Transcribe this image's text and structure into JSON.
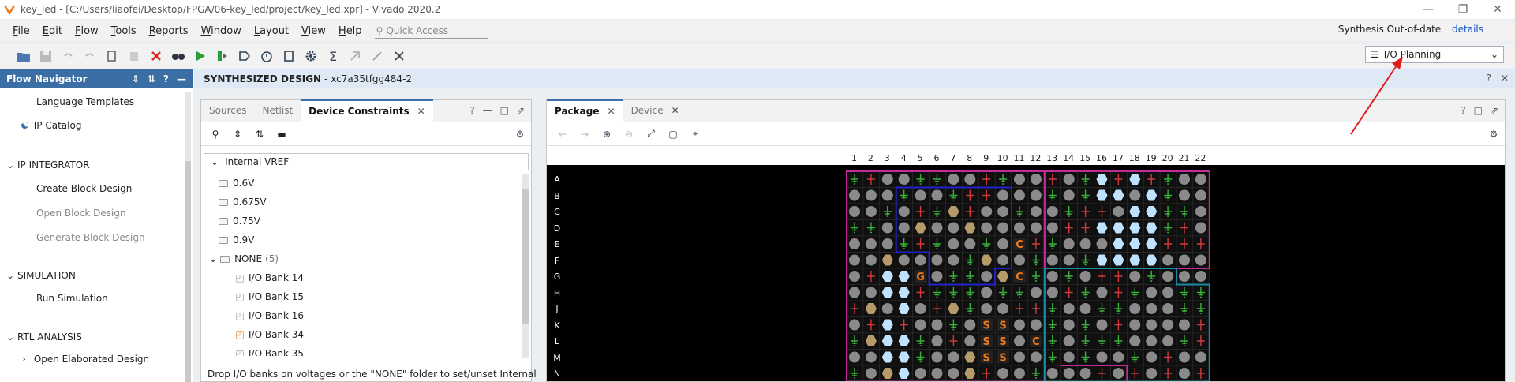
{
  "window": {
    "title": "key_led - [C:/Users/liaofei/Desktop/FPGA/06-key_led/project/key_led.xpr] - Vivado 2020.2"
  },
  "menu": [
    "File",
    "Edit",
    "Flow",
    "Tools",
    "Reports",
    "Window",
    "Layout",
    "View",
    "Help"
  ],
  "quick_access": {
    "placeholder": "Quick Access"
  },
  "status": {
    "text": "Synthesis Out-of-date",
    "link": "details"
  },
  "layout_select": {
    "value": "I/O Planning"
  },
  "flow_nav": {
    "title": "Flow Navigator",
    "items": [
      {
        "type": "item",
        "label": "Language Templates"
      },
      {
        "type": "item",
        "label": "IP Catalog"
      },
      {
        "type": "section",
        "label": "IP INTEGRATOR"
      },
      {
        "type": "item",
        "label": "Create Block Design"
      },
      {
        "type": "item",
        "label": "Open Block Design",
        "disabled": true
      },
      {
        "type": "item",
        "label": "Generate Block Design",
        "disabled": true
      },
      {
        "type": "section",
        "label": "SIMULATION"
      },
      {
        "type": "item",
        "label": "Run Simulation"
      },
      {
        "type": "section",
        "label": "RTL ANALYSIS"
      },
      {
        "type": "item",
        "label": "Open Elaborated Design"
      }
    ]
  },
  "main_header": {
    "title": "SYNTHESIZED DESIGN",
    "part": "- xc7a35tfgg484-2"
  },
  "left_panel": {
    "tabs": [
      "Sources",
      "Netlist",
      "Device Constraints"
    ],
    "tree_header": "Internal VREF",
    "tree": [
      {
        "label": "0.6V",
        "kind": "folder"
      },
      {
        "label": "0.675V",
        "kind": "folder"
      },
      {
        "label": "0.75V",
        "kind": "folder"
      },
      {
        "label": "0.9V",
        "kind": "folder"
      },
      {
        "label": "NONE",
        "count": "(5)",
        "kind": "folder-open"
      },
      {
        "label": "I/O Bank 14",
        "kind": "bank"
      },
      {
        "label": "I/O Bank 15",
        "kind": "bank"
      },
      {
        "label": "I/O Bank 16",
        "kind": "bank"
      },
      {
        "label": "I/O Bank 34",
        "kind": "bank-used"
      },
      {
        "label": "I/O Bank 35",
        "kind": "bank"
      }
    ],
    "footer": "Drop I/O banks on voltages or the \"NONE\" folder to set/unset Internal"
  },
  "right_panel": {
    "tabs": [
      "Package",
      "Device"
    ],
    "cols": [
      "1",
      "2",
      "3",
      "4",
      "5",
      "6",
      "7",
      "8",
      "9",
      "10",
      "11",
      "12",
      "13",
      "14",
      "15",
      "16",
      "17",
      "18",
      "19",
      "20",
      "21",
      "22"
    ],
    "rows": [
      "A",
      "B",
      "C",
      "D",
      "E",
      "F",
      "G",
      "H",
      "J",
      "K",
      "L",
      "M",
      "N"
    ]
  },
  "colors": {
    "accent": "#3b6ea5",
    "bank_magenta": "#c02c9a",
    "bank_blue": "#2222cc",
    "bank_teal": "#1b8aa6"
  }
}
